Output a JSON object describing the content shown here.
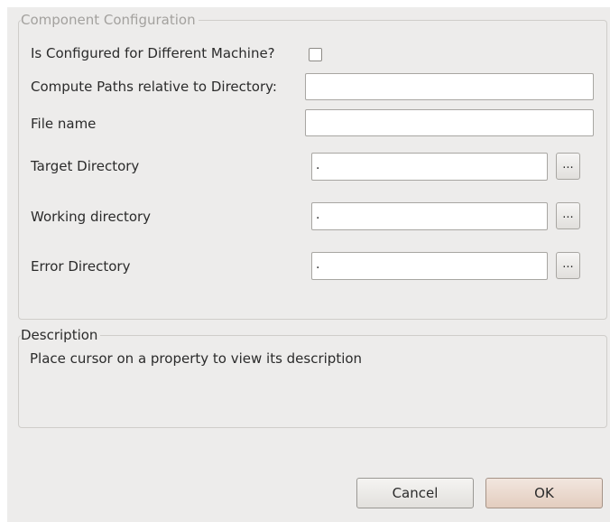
{
  "config_group": {
    "title": "Component Configuration",
    "different_machine": {
      "label": "Is Configured for Different Machine?",
      "checked": false
    },
    "compute_paths": {
      "label": "Compute Paths relative to Directory:",
      "value": ""
    },
    "file_name": {
      "label": "File name",
      "value": ""
    },
    "target_directory": {
      "label": "Target Directory",
      "value": ".",
      "browse_label": "..."
    },
    "working_directory": {
      "label": "Working directory",
      "value": ".",
      "browse_label": "..."
    },
    "error_directory": {
      "label": "Error Directory",
      "value": ".",
      "browse_label": "..."
    }
  },
  "description_group": {
    "title": "Description",
    "text": "Place cursor on a property to view its description"
  },
  "buttons": {
    "cancel_label": "Cancel",
    "ok_label": "OK"
  }
}
